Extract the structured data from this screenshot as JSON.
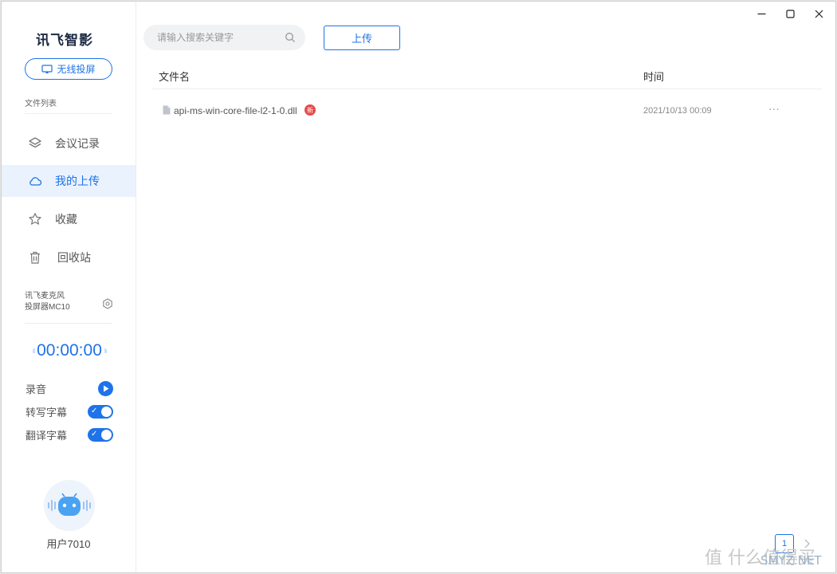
{
  "sidebar": {
    "logo": "讯飞智影",
    "cast_button": "无线投屏",
    "section_label": "文件列表",
    "nav": [
      {
        "label": "会议记录",
        "icon": "layers-icon"
      },
      {
        "label": "我的上传",
        "icon": "cloud-icon",
        "active": true
      },
      {
        "label": "收藏",
        "icon": "star-icon"
      },
      {
        "label": "回收站",
        "icon": "trash-icon"
      }
    ],
    "device_line1": "讯飞麦克风",
    "device_line2": "投屏器MC10",
    "timer": "00:00:00",
    "record_label": "录音",
    "transcribe_label": "转写字幕",
    "translate_label": "翻译字幕",
    "transcribe_on": true,
    "translate_on": true,
    "username": "用户7010"
  },
  "main": {
    "search_placeholder": "请输入搜索关键字",
    "upload_button": "上传",
    "columns": {
      "name": "文件名",
      "time": "时间"
    },
    "files": [
      {
        "name": "api-ms-win-core-file-l2-1-0.dll",
        "badge": "新",
        "time": "2021/10/13 00:09"
      }
    ],
    "page": "1",
    "watermark": "值 什么值得买",
    "watermark_sub": "SMYZ.NET"
  },
  "colors": {
    "accent": "#1e73e8",
    "badge": "#e84a4a",
    "active_bg": "#eaf2fd"
  }
}
